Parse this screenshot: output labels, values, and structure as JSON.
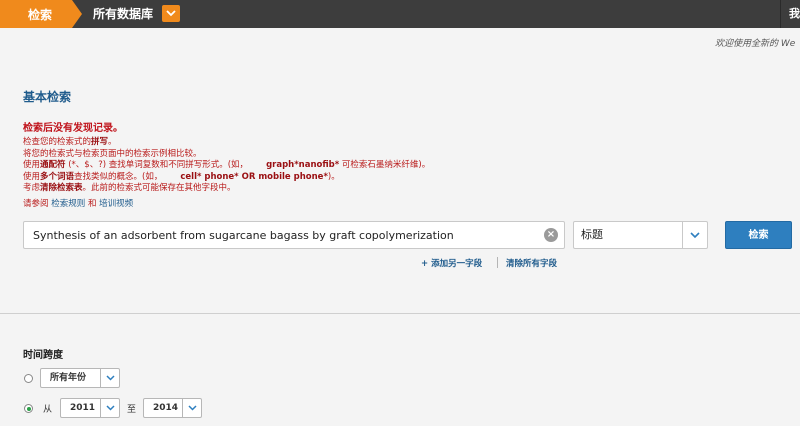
{
  "topbar": {
    "search_tab": "检索",
    "database_label": "所有数据库",
    "my_tools": "我的工具"
  },
  "welcome": "欢迎使用全新的 We",
  "section_title": "基本检索",
  "error": {
    "title": "检索后没有发现记录。",
    "line1": {
      "pre": "检查您的检索式的",
      "bold": "拼写",
      "post": "。"
    },
    "line2": "将您的检索式与检索页面中的检索示例相比较。",
    "line3": {
      "pre": "使用",
      "bold": "通配符",
      "post": " (*、$、?) 查找单词复数和不同拼写形式。(如，",
      "example": "graph*nanofib*",
      "tail": " 可检索石墨纳米纤维)。"
    },
    "line4": {
      "pre": "使用",
      "bold": "多个词语",
      "post": "查找类似的概念。(如，",
      "example": "cell* phone* OR mobile phone*",
      "tail": ")。"
    },
    "line5": {
      "pre": "考虑",
      "bold": "清除检索表",
      "post": "。此前的检索式可能保存在其他字段中。"
    },
    "ref_pre": "请参阅",
    "ref_link1": "检索规则",
    "ref_and": "和",
    "ref_link2": "培训视频"
  },
  "search": {
    "query": "Synthesis of an adsorbent from sugarcane bagass by graft copolymerization",
    "field": "标题",
    "button": "检索",
    "add_field": "+ 添加另一字段",
    "clear_all": "清除所有字段"
  },
  "timespan": {
    "title": "时间跨度",
    "all_years": "所有年份",
    "from_label": "从",
    "from_year": "2011",
    "to_label": "至",
    "to_year": "2014",
    "selected": "range"
  },
  "colors": {
    "accent_orange": "#f08a1c",
    "topbar": "#3d3d3d",
    "link_blue": "#1f5b8c",
    "error_red": "#c0141c",
    "button_blue": "#2e7fbf"
  }
}
